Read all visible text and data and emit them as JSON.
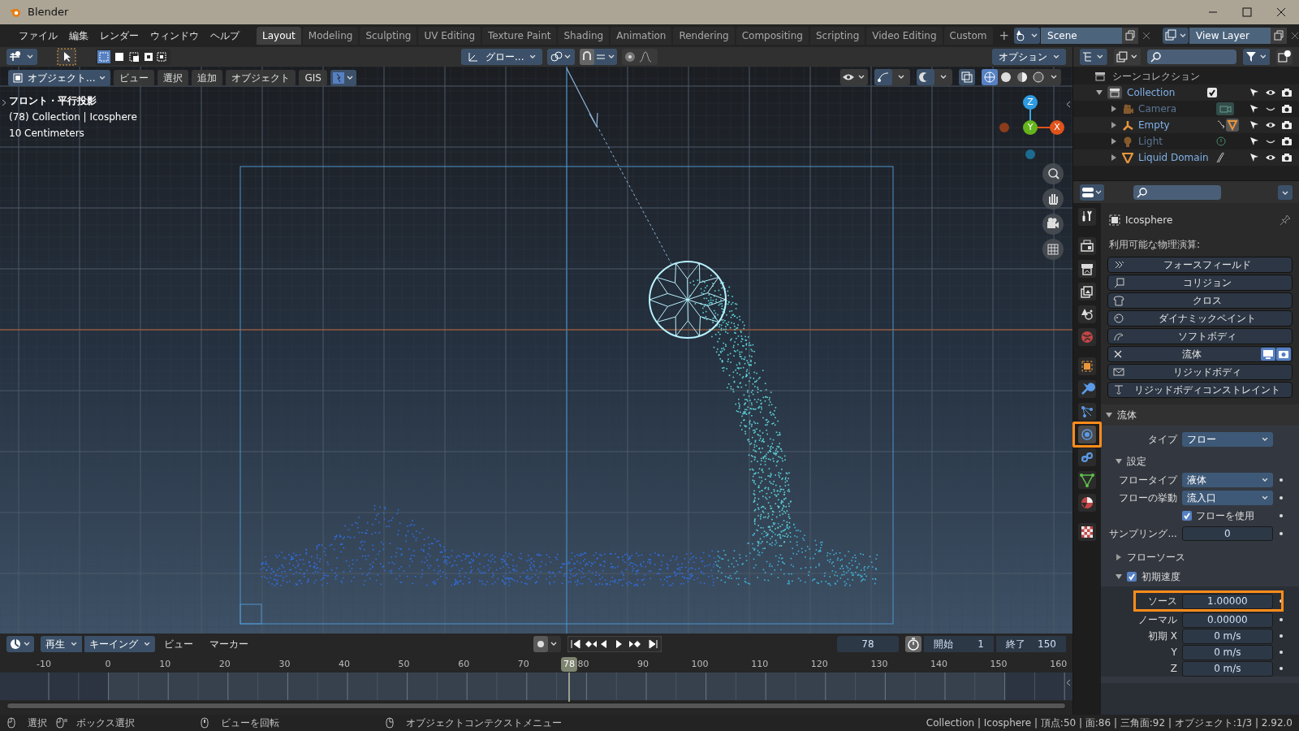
{
  "window": {
    "title": "Blender"
  },
  "menu": [
    "ファイル",
    "編集",
    "レンダー",
    "ウィンドウ",
    "ヘルプ"
  ],
  "workspaces": [
    {
      "label": "Layout",
      "selected": true
    },
    {
      "label": "Modeling",
      "selected": false
    },
    {
      "label": "Sculpting",
      "selected": false
    },
    {
      "label": "UV Editing",
      "selected": false
    },
    {
      "label": "Texture Paint",
      "selected": false
    },
    {
      "label": "Shading",
      "selected": false
    },
    {
      "label": "Animation",
      "selected": false
    },
    {
      "label": "Rendering",
      "selected": false
    },
    {
      "label": "Compositing",
      "selected": false
    },
    {
      "label": "Scripting",
      "selected": false
    },
    {
      "label": "Video Editing",
      "selected": false
    },
    {
      "label": "Custom",
      "selected": false
    }
  ],
  "add_workspace": "+",
  "scene": "Scene",
  "view_layer": "View Layer",
  "viewport_header": {
    "transform": "グロー...",
    "options": "オプション"
  },
  "viewport_toolbar": {
    "mode": "オブジェクト...",
    "menus": [
      "ビュー",
      "選択",
      "追加",
      "オブジェクト",
      "GIS"
    ]
  },
  "viewport_overlay": [
    "フロント・平行投影",
    "(78) Collection | Icosphere",
    "10 Centimeters"
  ],
  "gizmo": {
    "z": "Z",
    "y": "Y",
    "x": "X"
  },
  "outliner": {
    "root": "シーンコレクション",
    "collection": {
      "name": "Collection",
      "checked": true,
      "expanded": true,
      "children": [
        {
          "name": "Camera",
          "visible": false
        },
        {
          "name": "Empty",
          "visible": true
        },
        {
          "name": "Light",
          "visible": false
        },
        {
          "name": "Liquid Domain",
          "visible": true
        }
      ]
    }
  },
  "property_tabs": [
    {
      "kind": "tool",
      "selected": false,
      "annotated": false
    },
    {
      "kind": "render",
      "selected": false,
      "annotated": false
    },
    {
      "kind": "output",
      "selected": false,
      "annotated": false
    },
    {
      "kind": "view_layer",
      "selected": false,
      "annotated": false
    },
    {
      "kind": "scene",
      "selected": false,
      "annotated": false
    },
    {
      "kind": "world",
      "selected": false,
      "annotated": false
    },
    {
      "kind": "object",
      "selected": false,
      "annotated": false
    },
    {
      "kind": "modifier",
      "selected": false,
      "annotated": false
    },
    {
      "kind": "particles",
      "selected": false,
      "annotated": false
    },
    {
      "kind": "physics",
      "selected": true,
      "annotated": true
    },
    {
      "kind": "constraints",
      "selected": false,
      "annotated": false
    },
    {
      "kind": "data",
      "selected": false,
      "annotated": false
    },
    {
      "kind": "material",
      "selected": false,
      "annotated": false
    },
    {
      "kind": "texture",
      "selected": false,
      "annotated": false
    }
  ],
  "properties": {
    "object": "Icosphere",
    "heading": "利用可能な物理演算:",
    "physics": [
      {
        "label": "フォースフィールド",
        "enabled": false
      },
      {
        "label": "コリジョン",
        "enabled": false
      },
      {
        "label": "クロス",
        "enabled": false
      },
      {
        "label": "ダイナミックペイント",
        "enabled": false
      },
      {
        "label": "ソフトボディ",
        "enabled": false
      },
      {
        "label": "流体",
        "enabled": true
      },
      {
        "label": "リジッドボディ",
        "enabled": false
      },
      {
        "label": "リジッドボディコンストレイント",
        "enabled": false
      }
    ],
    "fluid": {
      "title": "流体",
      "expanded": true,
      "type_label": "タイプ",
      "type_value": "フロー",
      "settings": {
        "title": "設定",
        "expanded": true,
        "rows": [
          {
            "kind": "dropdown",
            "label": "フロータイプ",
            "value": "液体"
          },
          {
            "kind": "dropdown",
            "label": "フローの挙動",
            "value": "流入口"
          },
          {
            "kind": "checkbox",
            "label": "フローを使用",
            "checked": true
          },
          {
            "kind": "number",
            "label": "サンプリング...",
            "value": "0"
          }
        ]
      },
      "flow_source": {
        "title": "フローソース",
        "expanded": false
      },
      "initial_velocity": {
        "title": "初期速度",
        "expanded": true,
        "checked": true,
        "rows": [
          {
            "label": "ソース",
            "value": "1.00000",
            "annotated": true
          },
          {
            "label": "ノーマル",
            "value": "0.00000",
            "annotated": false
          },
          {
            "label": "初期 X",
            "value": "0 m/s",
            "annotated": false
          },
          {
            "label": "Y",
            "value": "0 m/s",
            "annotated": false
          },
          {
            "label": "Z",
            "value": "0 m/s",
            "annotated": false
          }
        ]
      }
    }
  },
  "timeline": {
    "menus": [
      "再生",
      "キーイング",
      "ビュー",
      "マーカー"
    ],
    "current_frame": "78",
    "start_label": "開始",
    "start": "1",
    "end_label": "終了",
    "end": "150",
    "ticks": [
      "-10",
      "0",
      "10",
      "20",
      "30",
      "40",
      "50",
      "60",
      "70",
      "80",
      "90",
      "100",
      "110",
      "120",
      "130",
      "140",
      "150",
      "160"
    ],
    "playhead": "78"
  },
  "status_bar": {
    "hints": [
      "選択",
      "ボックス選択",
      "ビューを回転",
      "オブジェクトコンテクストメニュー"
    ],
    "stats": "Collection | Icosphere | 頂点:50 | 面:86 | 三角面:92 | オブジェクト:1/3 | 2.92.0"
  }
}
